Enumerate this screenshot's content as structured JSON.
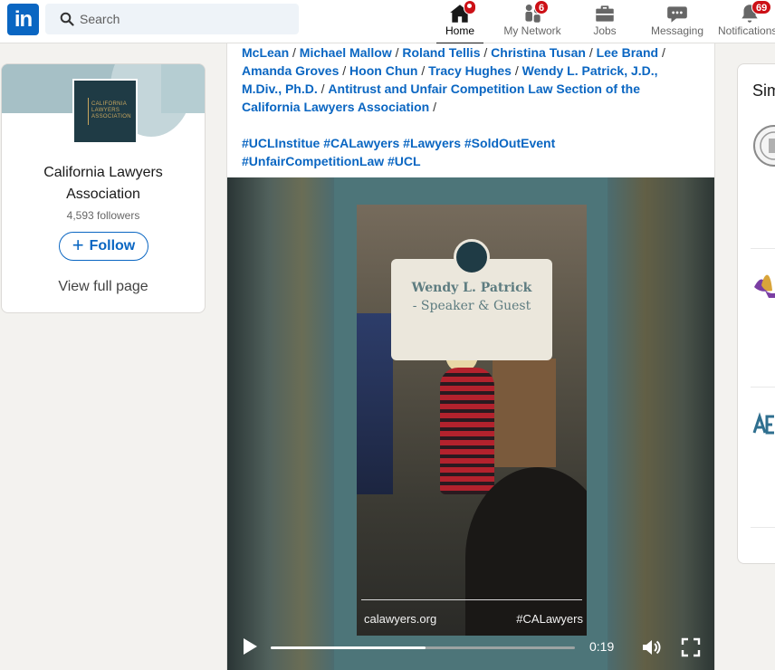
{
  "nav": {
    "logo_text": "in",
    "search_placeholder": "Search",
    "items": [
      {
        "label": "Home",
        "icon": "home-icon",
        "badge": ""
      },
      {
        "label": "My Network",
        "icon": "network-icon",
        "badge": "6"
      },
      {
        "label": "Jobs",
        "icon": "briefcase-icon",
        "badge": ""
      },
      {
        "label": "Messaging",
        "icon": "chat-icon",
        "badge": ""
      },
      {
        "label": "Notifications",
        "icon": "bell-icon",
        "badge": "69"
      }
    ]
  },
  "company": {
    "logo_lines": [
      "CALIFORNIA",
      "LAWYERS",
      "ASSOCIATION"
    ],
    "name": "California Lawyers Association",
    "followers": "4,593 followers",
    "follow_label": "Follow",
    "view_page_label": "View full page"
  },
  "post": {
    "mentions_line1": [
      "McLean",
      "Michael Mallow",
      "Roland Tellis",
      "Christina Tusan",
      "Lee Brand"
    ],
    "mentions_line2": [
      "Amanda Groves",
      "Hoon Chun",
      "Tracy Hughes",
      "Wendy L. Patrick, J.D., M.Div., Ph.D.",
      "Antitrust and Unfair Competition Law Section of the California Lawyers Association"
    ],
    "separator": "/",
    "hashtags": [
      "#UCLInstitue",
      "#CALawyers",
      "#Lawyers",
      "#SoldOutEvent",
      "#UnfairCompetitionLaw",
      "#UCL"
    ]
  },
  "video": {
    "speaker_name": "Wendy L. Patrick",
    "speaker_role": "- Speaker & Guest",
    "site": "calawyers.org",
    "tag": "#CALawyers",
    "time": "0:19",
    "progress": 0.51
  },
  "right": {
    "title": "Similar pages"
  },
  "colors": {
    "brand_blue": "#0a66c2",
    "badge_red": "#cc1016",
    "video_teal": "#4d7579"
  }
}
